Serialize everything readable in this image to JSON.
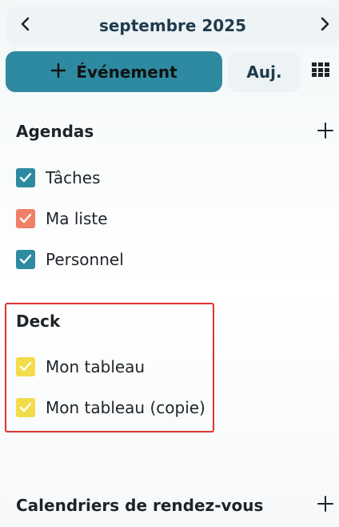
{
  "header": {
    "month": "septembre 2025",
    "prev_icon": "chevron-left-icon",
    "next_icon": "chevron-right-icon"
  },
  "toolbar": {
    "new_event_label": "Événement",
    "new_event_icon": "plus-icon",
    "today_label": "Auj.",
    "view_icon": "grid-view-icon"
  },
  "agendas": {
    "title": "Agendas",
    "add_icon": "plus-icon",
    "items": [
      {
        "label": "Tâches",
        "color": "#2e8aa0",
        "checked": true
      },
      {
        "label": "Ma liste",
        "color": "#f07f67",
        "checked": true
      },
      {
        "label": "Personnel",
        "color": "#2e8aa0",
        "checked": true
      }
    ]
  },
  "deck": {
    "title": "Deck",
    "items": [
      {
        "label": "Mon tableau",
        "color": "#f2dc4a",
        "checked": true
      },
      {
        "label": "Mon tableau (copie)",
        "color": "#f2dc4a",
        "checked": true
      }
    ],
    "highlight_color": "#e03434"
  },
  "appointments": {
    "title": "Calendriers de rendez-vous",
    "add_icon": "plus-icon"
  }
}
